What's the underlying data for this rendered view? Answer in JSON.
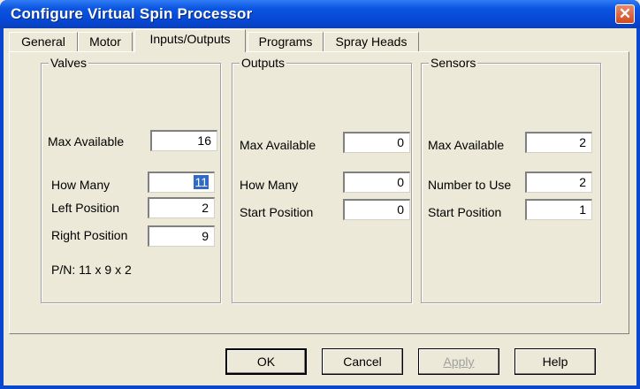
{
  "window": {
    "title": "Configure Virtual Spin Processor",
    "close_label": "✕"
  },
  "tabs": [
    {
      "label": "General"
    },
    {
      "label": "Motor"
    },
    {
      "label": "Inputs/Outputs"
    },
    {
      "label": "Programs"
    },
    {
      "label": "Spray Heads"
    }
  ],
  "valves": {
    "legend": "Valves",
    "max_available_label": "Max Available",
    "max_available": "16",
    "how_many_label": "How Many",
    "how_many": "11",
    "left_position_label": "Left Position",
    "left_position": "2",
    "right_position_label": "Right Position",
    "right_position": "9",
    "pn_text": "P/N:  11 x 9 x 2"
  },
  "outputs": {
    "legend": "Outputs",
    "max_available_label": "Max Available",
    "max_available": "0",
    "how_many_label": "How Many",
    "how_many": "0",
    "start_position_label": "Start Position",
    "start_position": "0"
  },
  "sensors": {
    "legend": "Sensors",
    "max_available_label": "Max Available",
    "max_available": "2",
    "number_to_use_label": "Number to Use",
    "number_to_use": "2",
    "start_position_label": "Start Position",
    "start_position": "1"
  },
  "buttons": {
    "ok": "OK",
    "cancel": "Cancel",
    "apply": "Apply",
    "help": "Help"
  }
}
